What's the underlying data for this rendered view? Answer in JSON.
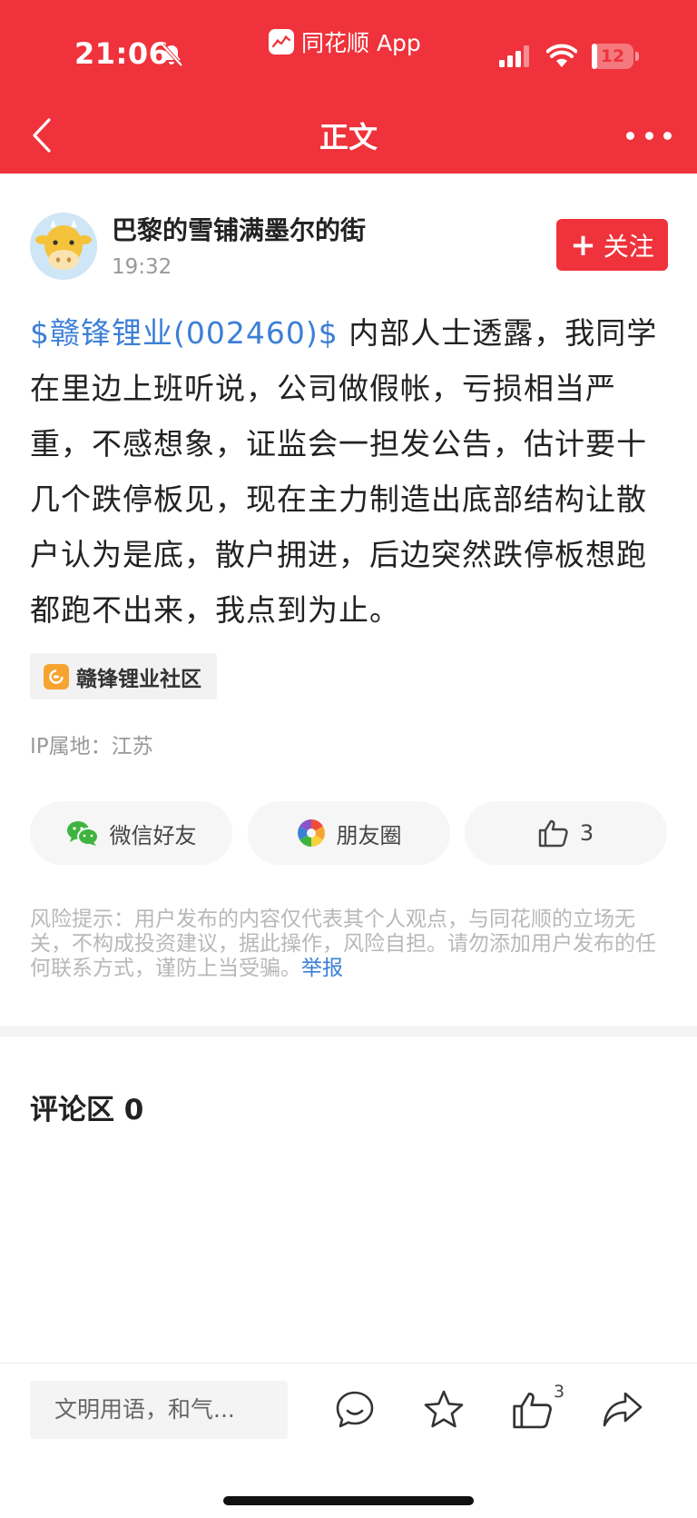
{
  "status_bar": {
    "time": "21:06",
    "app_name": "同花顺 App",
    "battery": "12",
    "battery_level": 0.12,
    "signal_bars": 3
  },
  "nav": {
    "title": "正文"
  },
  "post": {
    "author": "巴黎的雪铺满墨尔的街",
    "time": "19:32",
    "follow_label": "关注",
    "stock_tag": "$赣锋锂业(002460)$",
    "body": "内部人士透露，我同学在里边上班听说，公司做假帐，亏损相当严重，不感想象，证监会一担发公告，估计要十几个跌停板见，现在主力制造出底部结构让散户认为是底，散户拥进，后边突然跌停板想跑都跑不出来，我点到为止。",
    "community": "赣锋锂业社区",
    "ip_location": "IP属地：江苏"
  },
  "share": {
    "wechat_label": "微信好友",
    "moments_label": "朋友圈",
    "like_count": "3"
  },
  "risk": {
    "text": "风险提示：用户发布的内容仅代表其个人观点，与同花顺的立场无关，不构成投资建议，据此操作，风险自担。请勿添加用户发布的任何联系方式，谨防上当受骗。",
    "report_label": "举报"
  },
  "comments": {
    "title": "评论区 0"
  },
  "bottom_bar": {
    "input_placeholder": "文明用语，和气...",
    "like_count": "3"
  },
  "colors": {
    "brand_red": "#ef323b",
    "link_blue": "#3c7fd6",
    "wechat_green": "#3fb33f",
    "community_orange": "#f7a330"
  },
  "icons": [
    "back-arrow-icon",
    "more-icon",
    "mute-bell-icon",
    "signal-icon",
    "wifi-icon",
    "battery-icon",
    "wechat-icon",
    "moments-icon",
    "thumbs-up-icon",
    "comment-icon",
    "star-icon",
    "share-icon"
  ]
}
